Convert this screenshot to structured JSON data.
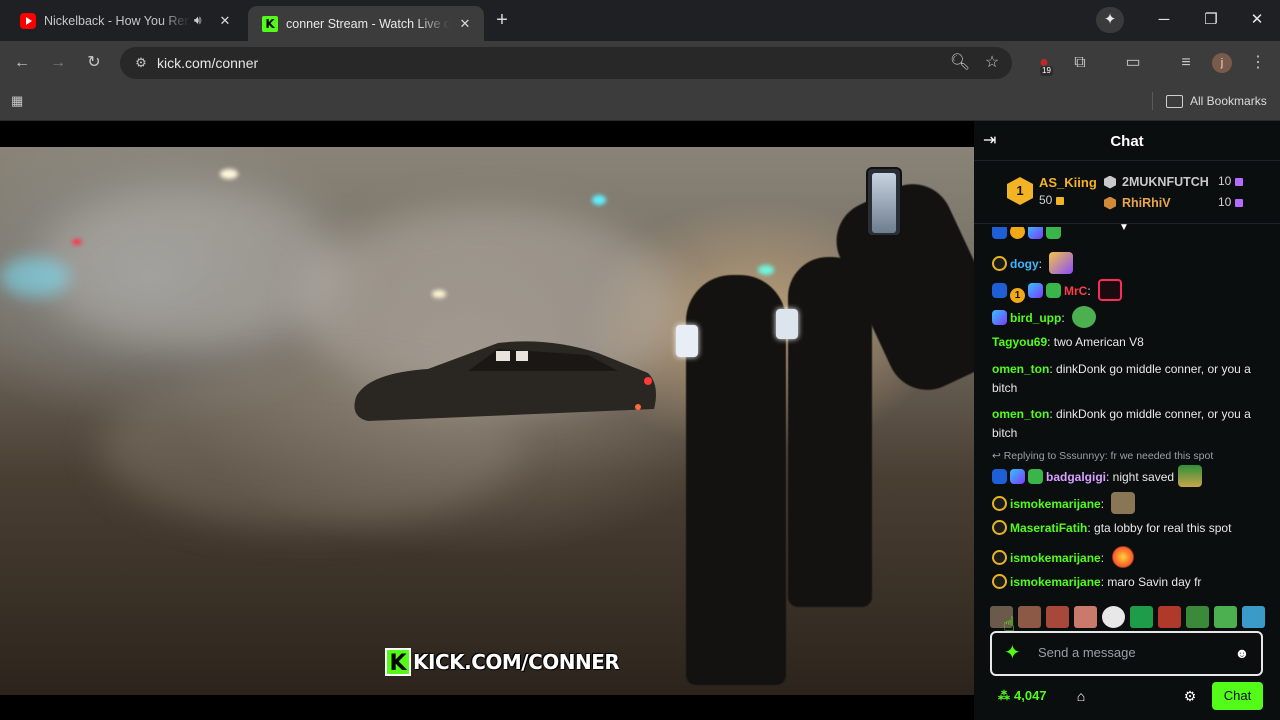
{
  "browser": {
    "tabs": [
      {
        "title": "Nickelback - How You Remind Me",
        "favicon": "youtube-icon",
        "audio": true
      },
      {
        "title": "conner Stream - Watch Live on Kick",
        "favicon": "kick-icon",
        "active": true
      }
    ],
    "new_tab_label": "+",
    "url": "kick.com/conner",
    "extension_badge": "19",
    "profile_initial": "j",
    "bookmarks_label": "All Bookmarks"
  },
  "video": {
    "overlay_logo": "K",
    "overlay_text": "KICK.COM/CONNER"
  },
  "chat": {
    "title": "Chat",
    "leaderboard": {
      "first": {
        "rank": "1",
        "name": "AS_Kiing",
        "value": "50"
      },
      "second": {
        "name": "2MUKNFUTCH",
        "value": "10"
      },
      "third": {
        "name": "RhiRhiV",
        "value": "10"
      }
    },
    "messages": [
      {
        "user": "dogy",
        "text": "",
        "color": "#3db7ff"
      },
      {
        "user": "MrC",
        "text": "",
        "color": "#ff3b4d"
      },
      {
        "user": "bird_upp",
        "text": "",
        "color": "#53fc18"
      },
      {
        "user": "Tagyou69",
        "text": "two American V8",
        "color": "#53fc18"
      },
      {
        "user": "omen_ton",
        "text": "dinkDonk go middle conner, or you a bitch",
        "color": "#53fc18"
      },
      {
        "user": "omen_ton",
        "text": "dinkDonk go middle conner, or you a bitch",
        "color": "#53fc18"
      },
      {
        "user": "badgalgigi",
        "text": "night saved",
        "color": "#d9a0ff"
      },
      {
        "user": "ismokemarijane",
        "text": "",
        "color": "#53fc18"
      },
      {
        "user": "MaseratiFatih",
        "text": "gta lobby for real this spot",
        "color": "#53fc18"
      },
      {
        "user": "ismokemarijane",
        "text": "",
        "color": "#53fc18"
      },
      {
        "user": "ismokemarijane",
        "text": "maro Savin day fr",
        "color": "#53fc18"
      }
    ],
    "reply_context": "Replying to Sssunnyy: fr we needed this spot",
    "input_placeholder": "Send a message",
    "points": "4,047",
    "send_label": "Chat"
  },
  "colors": {
    "kick_green": "#53fc18",
    "gold": "#f2b324",
    "chat_bg": "#0b0e0f"
  }
}
